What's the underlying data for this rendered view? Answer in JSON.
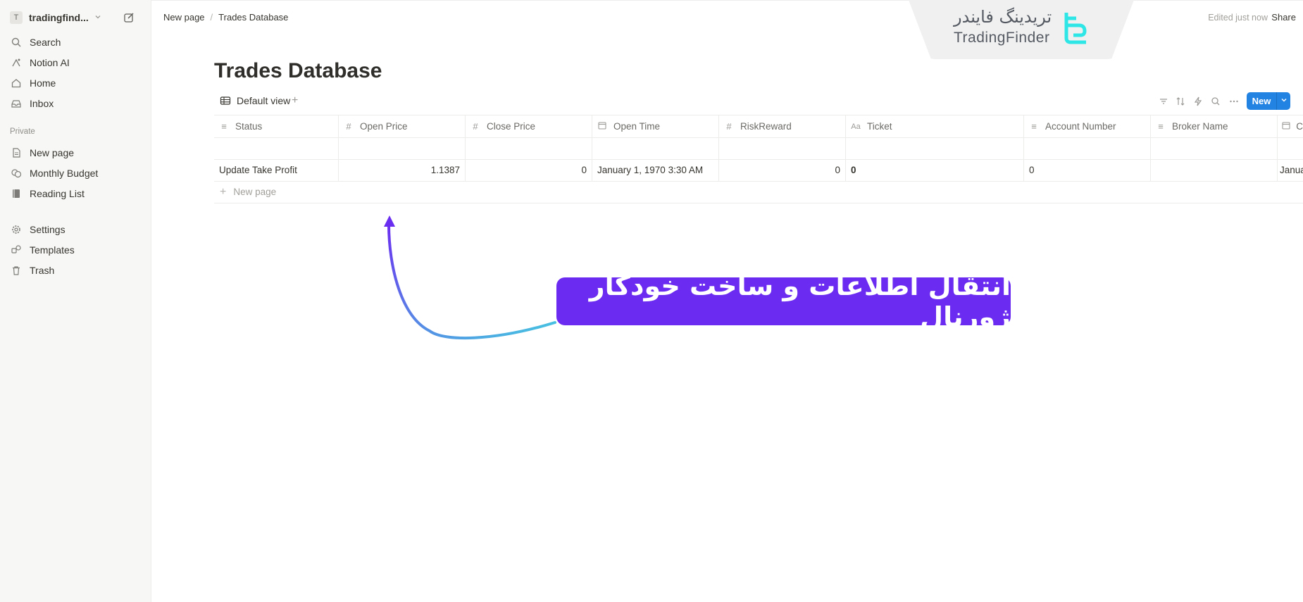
{
  "sidebar": {
    "workspace": {
      "initial": "T",
      "name": "tradingfind...",
      "caret": "chevron-down-icon"
    },
    "top_items": [
      {
        "label": "Search",
        "icon": "search-icon"
      },
      {
        "label": "Notion AI",
        "icon": "notion-ai-icon"
      },
      {
        "label": "Home",
        "icon": "home-icon"
      },
      {
        "label": "Inbox",
        "icon": "inbox-icon"
      }
    ],
    "section_private": "Private",
    "pages": [
      {
        "label": "New page",
        "icon": "page-icon"
      },
      {
        "label": "Monthly Budget",
        "icon": "coins-icon"
      },
      {
        "label": "Reading List",
        "icon": "book-icon"
      }
    ],
    "bottom_items": [
      {
        "label": "Settings",
        "icon": "gear-icon"
      },
      {
        "label": "Templates",
        "icon": "templates-icon"
      },
      {
        "label": "Trash",
        "icon": "trash-icon"
      }
    ]
  },
  "topbar": {
    "breadcrumb": [
      "New page",
      "Trades Database"
    ],
    "separator": "/",
    "edited": "Edited just now",
    "share": "Share"
  },
  "logo": {
    "fa": "تریدینگ فایندر",
    "en": "TradingFinder",
    "accent": "#2ee6e6"
  },
  "page": {
    "title": "Trades Database",
    "view_tab": "Default view",
    "add_view": "+",
    "new_button": "New",
    "new_button_color": "#2383e2"
  },
  "table": {
    "columns": [
      {
        "label": "Status",
        "icon": "text-icon"
      },
      {
        "label": "Open Price",
        "icon": "number-icon"
      },
      {
        "label": "Close Price",
        "icon": "number-icon"
      },
      {
        "label": "Open Time",
        "icon": "date-icon"
      },
      {
        "label": "RiskReward",
        "icon": "number-icon"
      },
      {
        "label": "Ticket",
        "icon": "title-icon"
      },
      {
        "label": "Account Number",
        "icon": "text-icon"
      },
      {
        "label": "Broker Name",
        "icon": "text-icon"
      },
      {
        "label": "C",
        "icon": "date-icon"
      }
    ],
    "rows": [
      [
        "",
        "",
        "",
        "",
        "",
        "",
        "",
        "",
        ""
      ],
      [
        "Update Take Profit",
        "1.1387",
        "0",
        "January 1, 1970 3:30 AM",
        "0",
        "0",
        "0",
        "",
        "Janua"
      ]
    ],
    "new_row": "New page"
  },
  "annotation": {
    "text": "انتقال اطلاعات و ساخت خودکار ژورنال",
    "color": "#6c2bf0"
  }
}
